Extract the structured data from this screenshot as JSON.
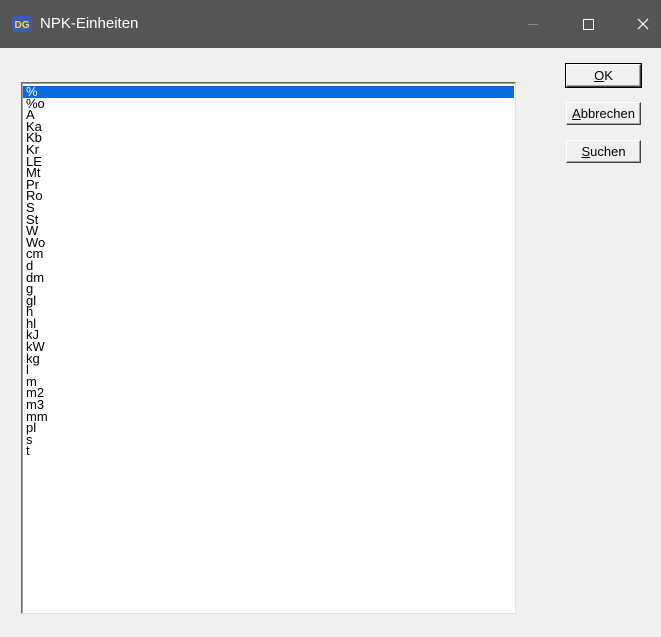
{
  "window": {
    "title": "NPK-Einheiten",
    "app_icon": "dg-logo-icon",
    "colors": {
      "titlebar": "#555555",
      "selection": "#0a6cdc",
      "background": "#f0f0f0"
    }
  },
  "listbox": {
    "selected_index": 0,
    "items": [
      "%",
      "%o",
      "A",
      "Ka",
      "Kb",
      "Kr",
      "LE",
      "Mt",
      "Pr",
      "Ro",
      "S",
      "St",
      "W",
      "Wo",
      "cm",
      "d",
      "dm",
      "g",
      "gl",
      "h",
      "hl",
      "kJ",
      "kW",
      "kg",
      "l",
      "m",
      "m2",
      "m3",
      "mm",
      "pl",
      "s",
      "t"
    ]
  },
  "buttons": {
    "ok": {
      "mnemonic": "O",
      "rest": "K"
    },
    "cancel": {
      "mnemonic": "A",
      "rest": "bbrechen"
    },
    "search": {
      "mnemonic": "S",
      "rest": "uchen"
    }
  }
}
